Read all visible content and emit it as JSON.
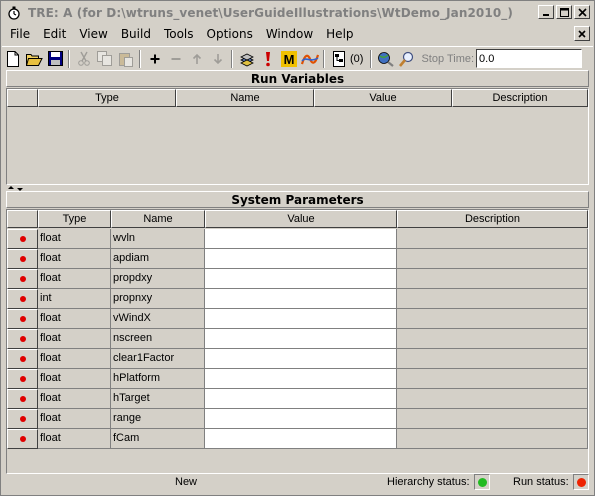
{
  "window": {
    "title": "TRE:  A (for D:\\wtruns_venet\\UserGuideIllustrations\\WtDemo_Jan2010_)",
    "app_icon": "stopwatch-icon",
    "caption_buttons": [
      "minimize",
      "maximize",
      "close"
    ]
  },
  "menu": [
    "File",
    "Edit",
    "View",
    "Build",
    "Tools",
    "Options",
    "Window",
    "Help"
  ],
  "toolbar": {
    "buttons": [
      {
        "name": "new-file-icon",
        "enabled": true
      },
      {
        "name": "open-folder-icon",
        "enabled": true
      },
      {
        "name": "save-icon",
        "enabled": true
      },
      {
        "name": "cut-icon",
        "enabled": false
      },
      {
        "name": "copy-icon",
        "enabled": false
      },
      {
        "name": "paste-icon",
        "enabled": false
      },
      {
        "name": "add-icon",
        "enabled": true
      },
      {
        "name": "remove-icon",
        "enabled": false
      },
      {
        "name": "move-up-icon",
        "enabled": false
      },
      {
        "name": "move-down-icon",
        "enabled": false
      },
      {
        "name": "build-icon",
        "enabled": true
      },
      {
        "name": "exclamation-icon",
        "enabled": true
      },
      {
        "name": "matlab-icon",
        "enabled": true
      },
      {
        "name": "chart-icon",
        "enabled": true
      },
      {
        "name": "hierarchy-icon",
        "enabled": true
      },
      {
        "name": "globe-search-icon",
        "enabled": true
      },
      {
        "name": "magnify-icon",
        "enabled": true
      }
    ],
    "hierarchy_count": "(0)",
    "stop_time_label": "Stop Time:",
    "stop_time_value": "0.0"
  },
  "run_variables": {
    "title": "Run Variables",
    "columns": [
      "Type",
      "Name",
      "Value",
      "Description"
    ],
    "rows": []
  },
  "system_parameters": {
    "title": "System Parameters",
    "columns": [
      "Type",
      "Name",
      "Value",
      "Description"
    ],
    "rows": [
      {
        "type": "float",
        "name": "wvln",
        "value": "",
        "description": ""
      },
      {
        "type": "float",
        "name": "apdiam",
        "value": "",
        "description": ""
      },
      {
        "type": "float",
        "name": "propdxy",
        "value": "",
        "description": ""
      },
      {
        "type": "int",
        "name": "propnxy",
        "value": "",
        "description": ""
      },
      {
        "type": "float",
        "name": "vWindX",
        "value": "",
        "description": ""
      },
      {
        "type": "float",
        "name": "nscreen",
        "value": "",
        "description": ""
      },
      {
        "type": "float",
        "name": "clear1Factor",
        "value": "",
        "description": ""
      },
      {
        "type": "float",
        "name": "hPlatform",
        "value": "",
        "description": ""
      },
      {
        "type": "float",
        "name": "hTarget",
        "value": "",
        "description": ""
      },
      {
        "type": "float",
        "name": "range",
        "value": "",
        "description": ""
      },
      {
        "type": "float",
        "name": "fCam",
        "value": "",
        "description": ""
      }
    ]
  },
  "status": {
    "state": "New",
    "hierarchy_label": "Hierarchy status:",
    "hierarchy_color": "#22bb22",
    "run_label": "Run status:",
    "run_color": "#ee2200"
  }
}
